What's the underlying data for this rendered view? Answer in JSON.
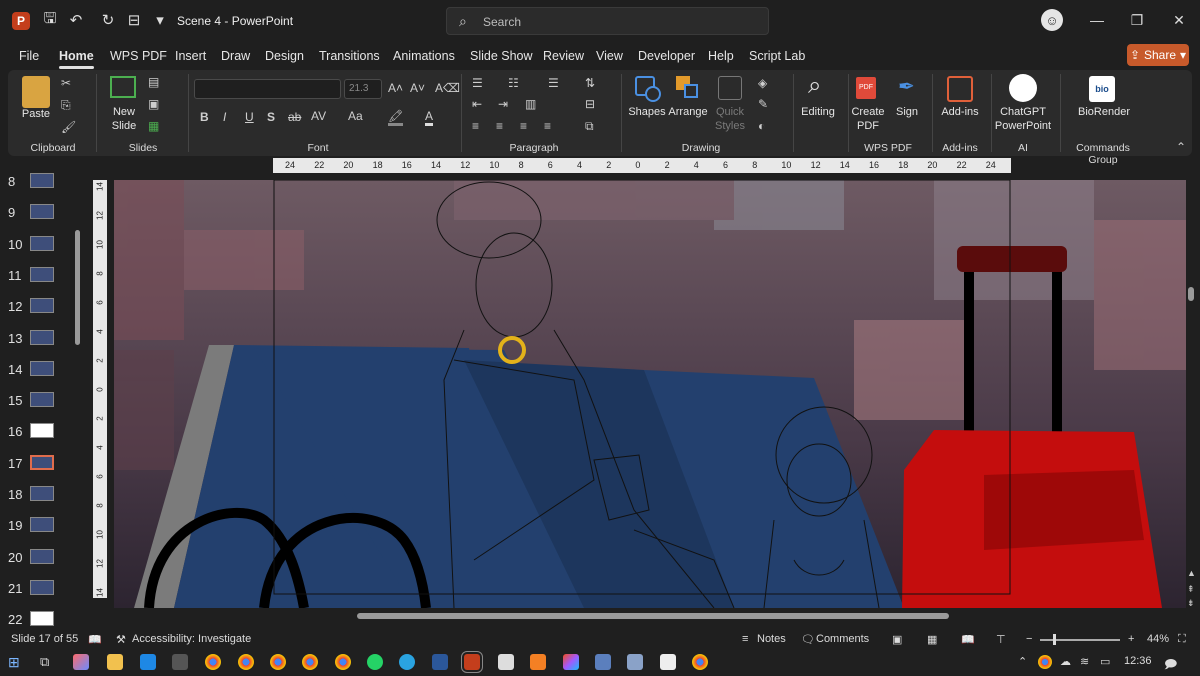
{
  "titlebar": {
    "doc_title": "Scene 4  -  PowerPoint",
    "search_placeholder": "Search",
    "undo_icon": "undo-icon",
    "redo_icon": "redo-icon"
  },
  "menu": {
    "tabs": [
      "File",
      "Home",
      "WPS PDF",
      "Insert",
      "Draw",
      "Design",
      "Transitions",
      "Animations",
      "Slide Show",
      "Review",
      "View",
      "Developer",
      "Help",
      "Script Lab"
    ],
    "active": "Home",
    "share_label": "Share"
  },
  "ribbon": {
    "groups": {
      "clipboard": "Clipboard",
      "slides": "Slides",
      "font": "Font",
      "paragraph": "Paragraph",
      "drawing": "Drawing",
      "wps_pdf": "WPS PDF",
      "addins": "Add-ins",
      "ai": "AI",
      "commands": "Commands Group"
    },
    "buttons": {
      "paste": "Paste",
      "new_slide_1": "New",
      "new_slide_2": "Slide",
      "font_size": "21.3",
      "shapes": "Shapes",
      "arrange": "Arrange",
      "quick_styles_1": "Quick",
      "quick_styles_2": "Styles",
      "editing": "Editing",
      "create_pdf_1": "Create",
      "create_pdf_2": "PDF",
      "sign": "Sign",
      "addins": "Add-ins",
      "chatgpt_1": "ChatGPT",
      "chatgpt_2": "PowerPoint",
      "biorender": "BioRender",
      "bold": "B",
      "italic": "I",
      "underline": "U",
      "shadow": "S",
      "strike": "ab"
    }
  },
  "ruler": {
    "h_ticks": [
      "24",
      "22",
      "20",
      "18",
      "16",
      "14",
      "12",
      "10",
      "8",
      "6",
      "4",
      "2",
      "0",
      "2",
      "4",
      "6",
      "8",
      "10",
      "12",
      "14",
      "16",
      "18",
      "20",
      "22",
      "24"
    ],
    "v_ticks": [
      "14",
      "12",
      "10",
      "8",
      "6",
      "4",
      "2",
      "0",
      "2",
      "4",
      "6",
      "8",
      "10",
      "12",
      "14"
    ]
  },
  "slides": {
    "rows": [
      {
        "num": "8"
      },
      {
        "num": "9"
      },
      {
        "num": "10"
      },
      {
        "num": "11"
      },
      {
        "num": "12"
      },
      {
        "num": "13"
      },
      {
        "num": "14"
      },
      {
        "num": "15"
      },
      {
        "num": "16"
      },
      {
        "num": "17"
      },
      {
        "num": "18"
      },
      {
        "num": "19"
      },
      {
        "num": "20"
      },
      {
        "num": "21"
      },
      {
        "num": "22"
      }
    ],
    "active": "17"
  },
  "status": {
    "slide_of": "Slide 17 of 55",
    "accessibility": "Accessibility: Investigate",
    "notes": "Notes",
    "comments": "Comments",
    "zoom": "44%"
  },
  "taskbar": {
    "time": "12:36"
  },
  "colors": {
    "accent": "#c75a2b",
    "ribbon_bg": "#2b2b2b",
    "bench_blue": "#23406e",
    "suitcase_red": "#c40d0d"
  }
}
